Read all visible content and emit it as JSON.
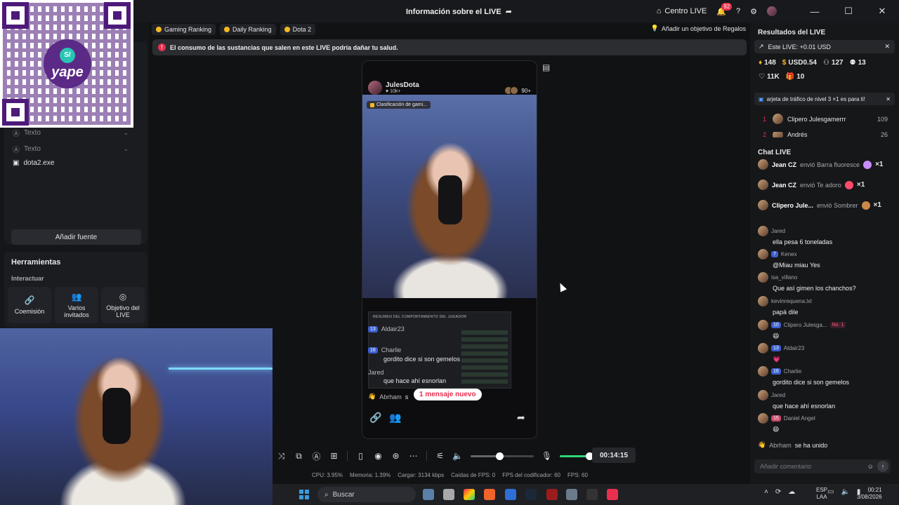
{
  "window": {
    "title": "Información sobre el LIVE",
    "centro_live": "Centro LIVE",
    "notifications": "92"
  },
  "tags": [
    {
      "label": "Gaming Ranking"
    },
    {
      "label": "Daily Ranking"
    },
    {
      "label": "Dota 2"
    }
  ],
  "goal_button": "Añadir un objetivo de Regalos",
  "warning": "El consumo de las sustancias que salen en este LIVE podría dañar tu salud.",
  "sources": {
    "items": [
      "Texto",
      "Texto",
      "dota2.exe"
    ],
    "add_label": "Añadir fuente"
  },
  "tools": {
    "title": "Herramientas",
    "subtitle": "Interactuar",
    "items": [
      "Coemisión",
      "Varios invitados",
      "Objetivo del LIVE"
    ]
  },
  "qr": {
    "brand": "yape",
    "symbol": "S/"
  },
  "preview": {
    "streamer": "JulesDota",
    "followers": "10k+",
    "viewers": "90+",
    "chip": "Clasificación de gami...",
    "game_header": "RESUMEN DEL COMPORTAMIENTO DEL JUGADOR",
    "chat": [
      {
        "level": "13",
        "name": "Aldair23",
        "text": ""
      },
      {
        "level": "16",
        "name": "Charlie",
        "text": "gordito dice si son gemelos"
      },
      {
        "level": "",
        "name": "Jared",
        "text": "que hace ahí esnorlan"
      },
      {
        "level": "",
        "name": "Abrham",
        "text": "s"
      }
    ],
    "new_message": "1 mensaje nuevo"
  },
  "controls": {
    "timer": "00:14:15",
    "volume_level": 0.45,
    "mic_level": 0.55
  },
  "stats": {
    "cpu": "CPU: 3.95%",
    "memoria": "Memoria: 1.39%",
    "cargar": "Cargar: 3134 kbps",
    "caidas": "Caídas de FPS: 0",
    "fps_cod": "FPS del codificador: 60",
    "fps": "FPS: 60"
  },
  "results": {
    "title": "Resultados del LIVE",
    "este_live": "Este LIVE: +0.01 USD",
    "row1": [
      "148",
      "USD0.54",
      "127",
      "13"
    ],
    "row2": [
      "11K",
      "10"
    ],
    "tarjeta": "arjeta de tráfico de nivel 3 ×1 es para ti!",
    "ranking": [
      {
        "pos": "1",
        "name": "Clipero Julesgamerrr",
        "score": "109"
      },
      {
        "pos": "2",
        "name": "Andrés",
        "score": "26"
      }
    ]
  },
  "chat": {
    "title": "Chat LIVE",
    "gifts": [
      {
        "name": "Jean CZ",
        "text": "envió Barra fluoresce",
        "count": "×1"
      },
      {
        "name": "Jean CZ",
        "text": "envió Te adoro",
        "count": "×1"
      },
      {
        "name": "Clipero Jule...",
        "text": "envió Sombrer",
        "count": "×1"
      }
    ],
    "messages": [
      {
        "level": "",
        "name": "Jared",
        "text": "ella pesa 6 toneladas"
      },
      {
        "level": "7",
        "name": "Kenex",
        "text": "@Miau miau Yes"
      },
      {
        "level": "",
        "name": "isa_villano",
        "text": "Que así gimen los chanchos?"
      },
      {
        "level": "",
        "name": "kevinrequena.lxl",
        "text": "papá dile"
      },
      {
        "level": "10",
        "name": "Clipero Julesga...",
        "badge": "No. 1",
        "text": "😄"
      },
      {
        "level": "13",
        "name": "Aldair23",
        "text": "💗"
      },
      {
        "level": "16",
        "name": "Charlie",
        "text": "gordito dice si son gemelos"
      },
      {
        "level": "",
        "name": "Jared",
        "text": "que hace ahí esnorlan"
      },
      {
        "level": "15",
        "name": "Daniel Angel",
        "text": "😄"
      }
    ],
    "joined": {
      "name": "Abrham",
      "text": "se ha unido"
    },
    "placeholder": "Añadir comentario"
  },
  "taskbar": {
    "search": "Buscar",
    "lang": [
      "ESP",
      "LAA"
    ],
    "time": "00:21",
    "date": "3/08/2026"
  }
}
